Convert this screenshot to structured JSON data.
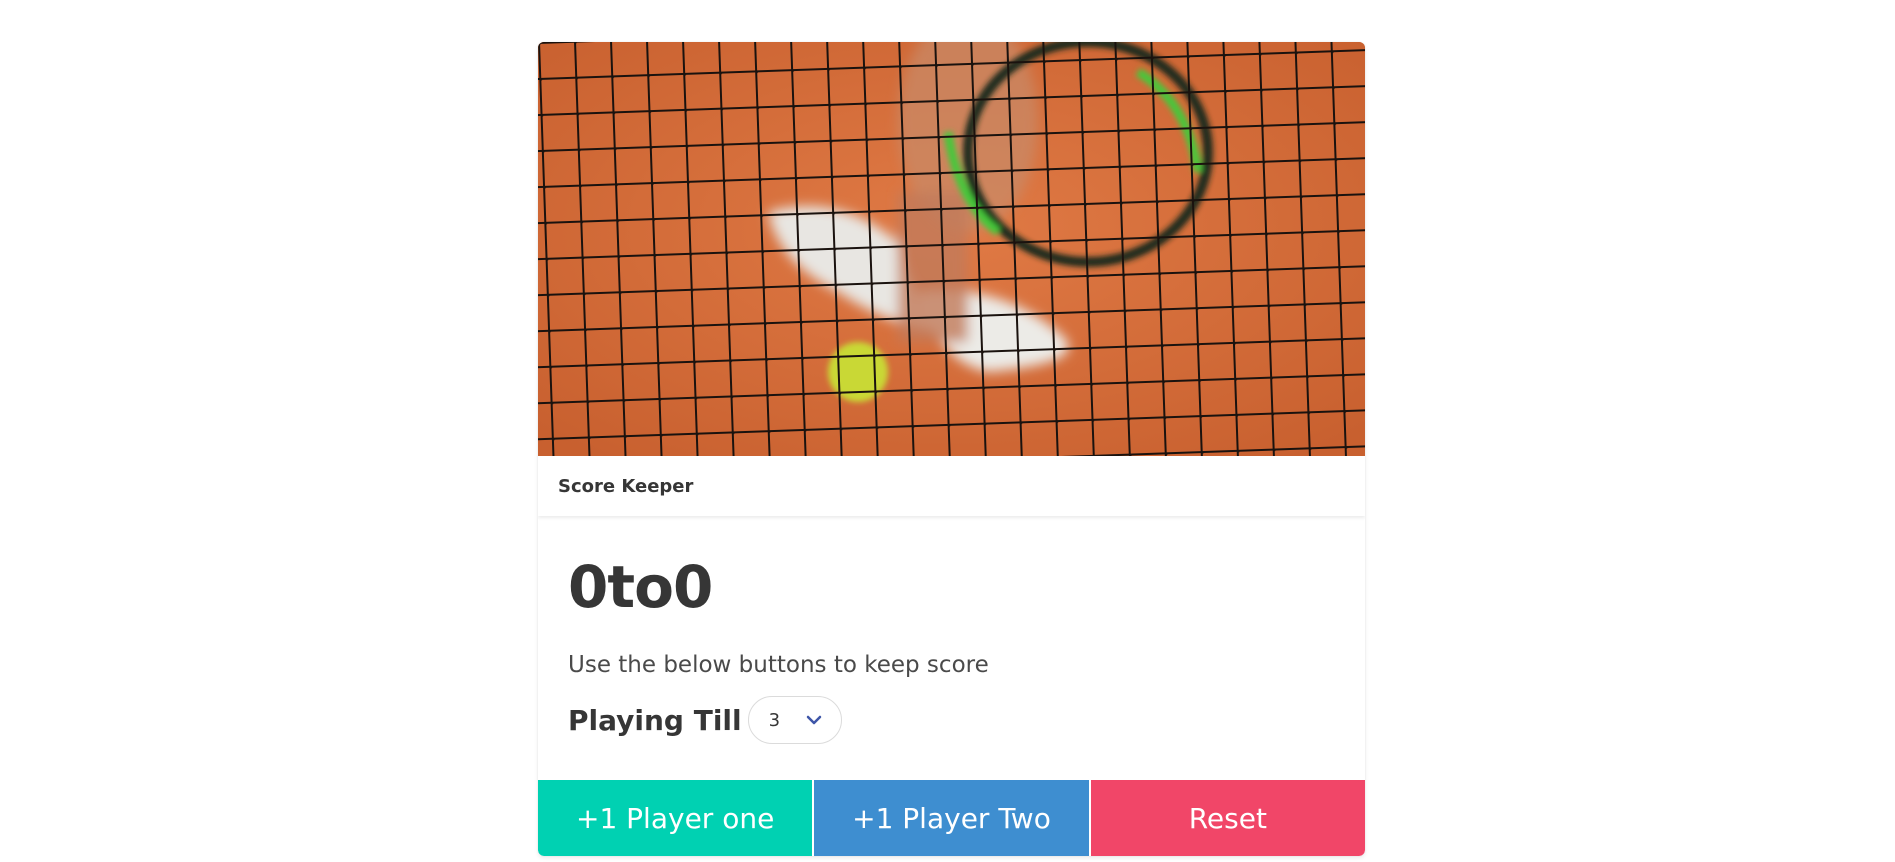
{
  "card": {
    "header_title": "Score Keeper",
    "score": {
      "player_one": "0",
      "separator": "to",
      "player_two": "0"
    },
    "subtitle": "Use the below buttons to keep score",
    "playing_till": {
      "label": "Playing Till",
      "selected": "3"
    },
    "buttons": {
      "player_one": "+1 Player one",
      "player_two": "+1 Player Two",
      "reset": "Reset"
    }
  },
  "colors": {
    "player_one_button": "#00d1b2",
    "player_two_button": "#3e8ed0",
    "reset_button": "#f14668",
    "select_chevron": "#3e56a8"
  },
  "icons": {
    "select_arrow": "chevron-down-icon"
  }
}
